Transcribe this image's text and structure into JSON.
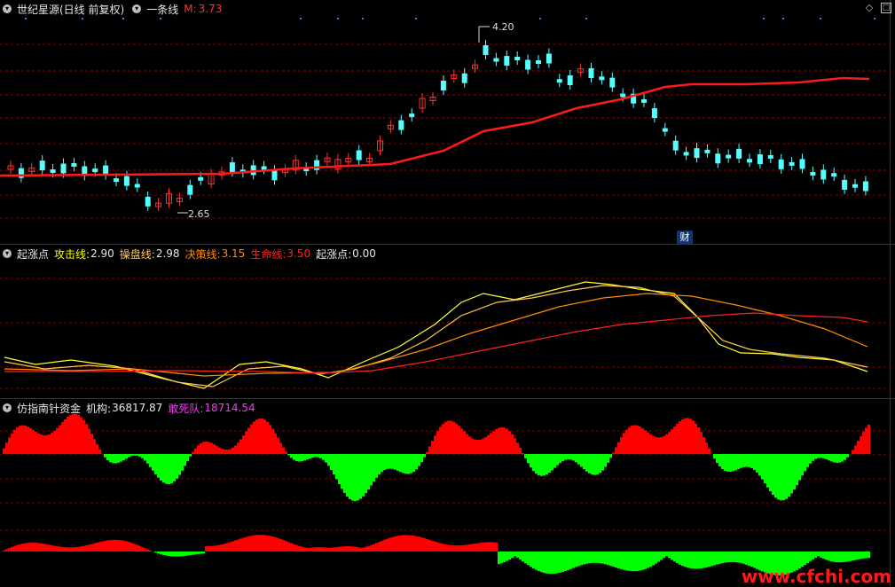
{
  "main_panel": {
    "title": "世纪星源(日线 前复权)",
    "indicator": "一条线",
    "m_label": "M:",
    "m_value": "3.73",
    "high_label": "4.20",
    "low_label": "2.65",
    "badge": "财"
  },
  "panel2": {
    "name": "起涨点",
    "items": [
      {
        "label": "攻击线:",
        "value": "2.90",
        "color": "#ffff00"
      },
      {
        "label": "操盘线:",
        "value": "2.98",
        "color": "#ffd060"
      },
      {
        "label": "决策线:",
        "value": "3.15",
        "color": "#ff8c00"
      },
      {
        "label": "生命线:",
        "value": "3.50",
        "color": "#ff2020"
      },
      {
        "label": "起涨点:",
        "value": "0.00",
        "color": "#d0d0d0"
      }
    ]
  },
  "panel3": {
    "name": "仿指南针资金",
    "items": [
      {
        "label": "机构:",
        "value": "36817.87",
        "color": "#e0e0e0"
      },
      {
        "label": "敢死队:",
        "value": "18714.54",
        "color": "#ff33ff"
      }
    ]
  },
  "watermark": "www.cfchi.com",
  "icons": [
    "diamond-icon",
    "window-icon"
  ],
  "colors": {
    "up": "#ff3030",
    "down": "#54ffff",
    "ma": "#ff1a1a",
    "grid": "#7a0000",
    "bar_up": "#ff0000",
    "bar_down": "#00ff00"
  }
}
